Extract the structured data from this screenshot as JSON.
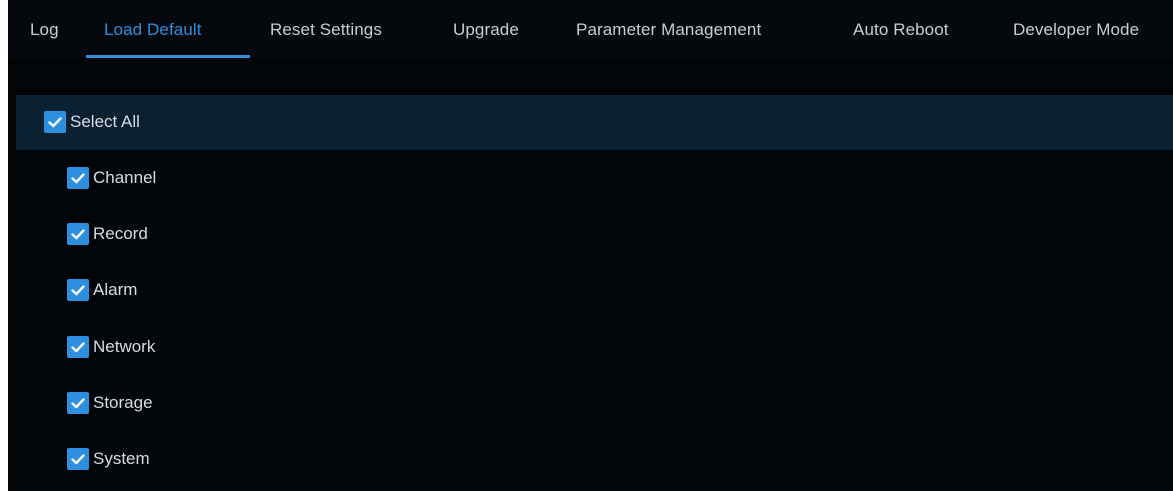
{
  "tabs": [
    {
      "label": "Log",
      "active": false
    },
    {
      "label": "Load Default",
      "active": true
    },
    {
      "label": "Reset Settings",
      "active": false
    },
    {
      "label": "Upgrade",
      "active": false
    },
    {
      "label": "Parameter Management",
      "active": false
    },
    {
      "label": "Auto Reboot",
      "active": false
    },
    {
      "label": "Developer Mode",
      "active": false
    }
  ],
  "select_all": {
    "label": "Select All",
    "checked": true
  },
  "options": [
    {
      "label": "Channel",
      "checked": true
    },
    {
      "label": "Record",
      "checked": true
    },
    {
      "label": "Alarm",
      "checked": true
    },
    {
      "label": "Network",
      "checked": true
    },
    {
      "label": "Storage",
      "checked": true
    },
    {
      "label": "System",
      "checked": true
    }
  ],
  "colors": {
    "accent": "#2e8fdf",
    "background": "#030609",
    "highlight_row": "#0b2033",
    "text": "#d8dce0"
  },
  "icons": {
    "checkbox": "checkmark-icon"
  }
}
